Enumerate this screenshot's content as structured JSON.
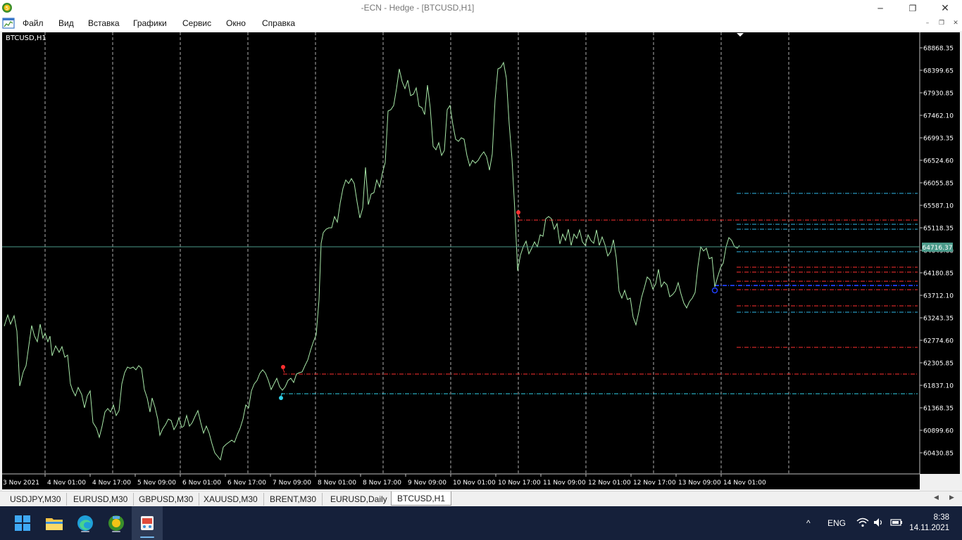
{
  "window": {
    "title": "-ECN - Hedge - [BTCUSD,H1]",
    "minimize_glyph": "─",
    "maximize_glyph": "❐",
    "close_glyph": "✕"
  },
  "menu": {
    "items": [
      "Файл",
      "Вид",
      "Вставка",
      "Графики",
      "Сервис",
      "Окно",
      "Справка"
    ],
    "mdi_controls": [
      "–",
      "❐",
      "✕"
    ]
  },
  "chart": {
    "label": "BTCUSD,H1",
    "background": "#000000",
    "price_line_color": "#a8e8a8",
    "current_price": "64716.37",
    "current_price_color": "#4a9a8a",
    "price_labels": [
      "68868.35",
      "68399.65",
      "67930.85",
      "67462.10",
      "66993.35",
      "66524.60",
      "66055.85",
      "65587.10",
      "65118.35",
      "64649.60",
      "64180.85",
      "63712.10",
      "63243.35",
      "62774.60",
      "62305.85",
      "61837.10",
      "61368.35",
      "60899.60",
      "60430.85"
    ],
    "time_labels": [
      "3 Nov 2021",
      "4 Nov 01:00",
      "4 Nov 17:00",
      "5 Nov 09:00",
      "6 Nov 01:00",
      "6 Nov 17:00",
      "7 Nov 09:00",
      "8 Nov 01:00",
      "8 Nov 17:00",
      "9 Nov 09:00",
      "10 Nov 01:00",
      "10 Nov 17:00",
      "11 Nov 09:00",
      "12 Nov 01:00",
      "12 Nov 17:00",
      "13 Nov 09:00",
      "14 Nov 01:00"
    ]
  },
  "tabs": {
    "items": [
      "USDJPY,M30",
      "EURUSD,M30",
      "GBPUSD,M30",
      "XAUUSD,M30",
      "BRENT,M30",
      "EURUSD,Daily",
      "BTCUSD,H1"
    ],
    "active": "BTCUSD,H1",
    "left_arrow": "◀",
    "right_arrow": "▶"
  },
  "taskbar": {
    "background": "#15203a",
    "apps": [
      "start-icon",
      "file-explorer-icon",
      "edge-browser-icon",
      "metatrader-icon",
      "snipping-tool-icon"
    ],
    "tray_chevron": "^",
    "language": "ENG",
    "time": "8:38",
    "date": "14.11.2021"
  }
}
